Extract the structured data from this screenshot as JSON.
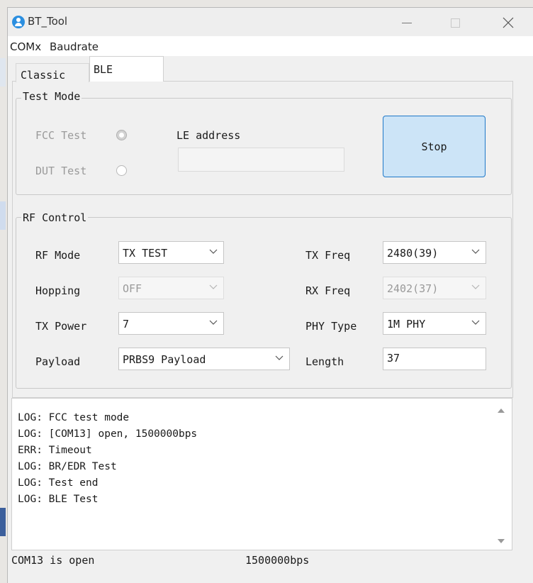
{
  "window": {
    "title": "BT_Tool"
  },
  "menu": {
    "items": [
      "COMx",
      "Baudrate"
    ]
  },
  "tabs": {
    "classic": "Classic",
    "ble": "BLE",
    "selected": "BLE"
  },
  "test_mode": {
    "legend": "Test Mode",
    "fcc_label": "FCC Test",
    "dut_label": "DUT Test",
    "fcc_checked": true,
    "dut_checked": false,
    "le_address_label": "LE address",
    "le_address_value": "",
    "stop_button": "Stop"
  },
  "rf_control": {
    "legend": "RF Control",
    "rf_mode": {
      "label": "RF Mode",
      "value": "TX TEST"
    },
    "hopping": {
      "label": "Hopping",
      "value": "OFF",
      "enabled": false
    },
    "tx_power": {
      "label": "TX Power",
      "value": "7"
    },
    "payload": {
      "label": "Payload",
      "value": "PRBS9 Payload"
    },
    "tx_freq": {
      "label": "TX Freq",
      "value": "2480(39)"
    },
    "rx_freq": {
      "label": "RX Freq",
      "value": "2402(37)",
      "enabled": false
    },
    "phy_type": {
      "label": "PHY Type",
      "value": "1M PHY"
    },
    "length": {
      "label": "Length",
      "value": "37"
    }
  },
  "log": {
    "lines": [
      "LOG: FCC test mode",
      "LOG: [COM13] open, 1500000bps",
      "ERR: Timeout",
      "LOG: BR/EDR Test",
      "LOG: Test end",
      "LOG: BLE Test"
    ]
  },
  "status_bar": {
    "port_status": "COM13 is open",
    "baudrate": "1500000bps"
  },
  "colors": {
    "stop_button_bg": "#cce4f7",
    "stop_button_border": "#1f78c8",
    "app_icon": "#2b8fe0"
  },
  "icons": {
    "app": "app-user-icon",
    "minimize": "minimize-icon",
    "maximize": "maximize-icon",
    "close": "close-icon",
    "dropdown": "chevron-down-icon",
    "scroll_up": "scroll-up-arrow-icon",
    "scroll_down": "scroll-down-arrow-icon"
  }
}
